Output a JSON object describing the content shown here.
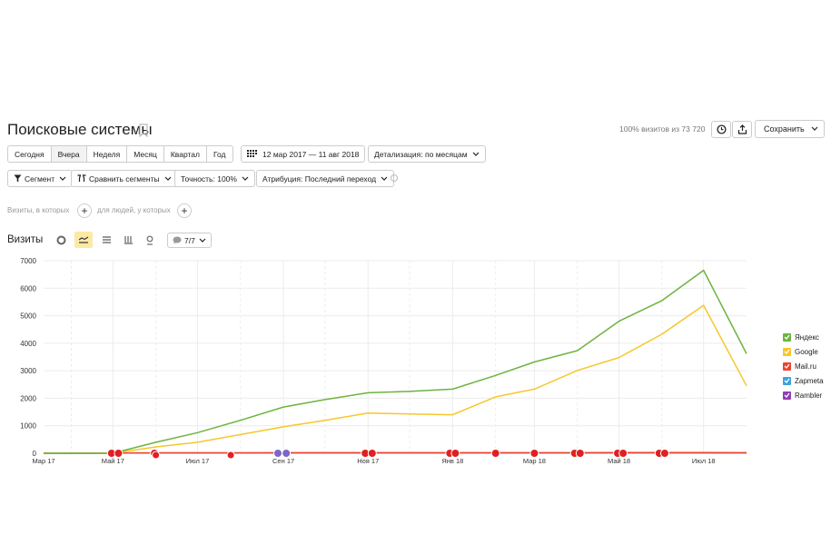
{
  "header": {
    "title": "Поисковые системы",
    "visits_info": "100% визитов из 73 720",
    "save_label": "Сохранить"
  },
  "periods": [
    "Сегодня",
    "Вчера",
    "Неделя",
    "Месяц",
    "Квартал",
    "Год"
  ],
  "date_range": "12 мар 2017 — 11 авг 2018",
  "detail": "Детализация: по месяцам",
  "toolbar": {
    "segment": "Сегмент",
    "compare": "Сравнить сегменты",
    "accuracy": "Точность: 100%",
    "attribution": "Атрибуция: Последний переход"
  },
  "filters": {
    "visits_where": "Визиты, в которых",
    "people_where": "для людей, у которых"
  },
  "chart_header": {
    "title": "Визиты",
    "comments": "7/7"
  },
  "colors": {
    "yandex": "#6db33f",
    "google": "#f6c72b",
    "mailru": "#e8442f",
    "zapmeta": "#3fa3e0",
    "rambler": "#8e3fb3",
    "marker_red": "#e02020",
    "marker_purple": "#7b68c8"
  },
  "chart_data": {
    "type": "line",
    "x": [
      "2017-03-12",
      "2017-04-01",
      "2017-05-01",
      "2017-06-01",
      "2017-07-01",
      "2017-08-01",
      "2017-09-01",
      "2017-10-01",
      "2017-11-01",
      "2017-12-01",
      "2018-01-01",
      "2018-02-01",
      "2018-03-01",
      "2018-04-01",
      "2018-05-01",
      "2018-06-01",
      "2018-07-01",
      "2018-08-01"
    ],
    "x_tick_labels": [
      "Мар 17",
      "Май 17",
      "Июл 17",
      "Сен 17",
      "Ноя 17",
      "Янв 18",
      "Мар 18",
      "Май 18",
      "Июл 18"
    ],
    "y_tick_labels": [
      "0",
      "1000",
      "2000",
      "3000",
      "4000",
      "5000",
      "6000",
      "7000"
    ],
    "ylim": [
      0,
      7000
    ],
    "series": [
      {
        "name": "Яндекс",
        "values": [
          0,
          0,
          0,
          400,
          750,
          1200,
          1680,
          1950,
          2200,
          2250,
          2330,
          2830,
          3320,
          3730,
          4800,
          5550,
          6650,
          3620
        ]
      },
      {
        "name": "Google",
        "values": [
          0,
          0,
          0,
          230,
          400,
          680,
          960,
          1200,
          1460,
          1430,
          1400,
          2050,
          2330,
          3010,
          3480,
          4330,
          5380,
          2450
        ]
      },
      {
        "name": "Mail.ru",
        "values": [
          0,
          0,
          10,
          15,
          15,
          15,
          20,
          20,
          20,
          20,
          20,
          20,
          20,
          20,
          25,
          25,
          25,
          20
        ]
      },
      {
        "name": "Zapmeta",
        "values": [
          0,
          0,
          5,
          5,
          5,
          5,
          5,
          5,
          5,
          5,
          5,
          5,
          5,
          5,
          5,
          5,
          5,
          5
        ]
      },
      {
        "name": "Rambler",
        "values": [
          0,
          0,
          5,
          5,
          5,
          5,
          5,
          5,
          5,
          5,
          5,
          5,
          5,
          5,
          5,
          5,
          5,
          5
        ]
      }
    ],
    "legend_position": "right",
    "grid": true
  }
}
